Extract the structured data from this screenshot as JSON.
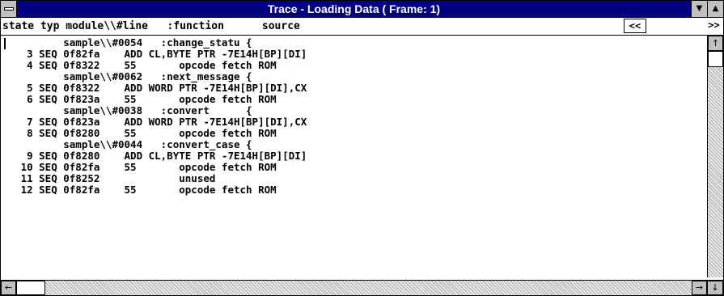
{
  "window": {
    "title": "Trace - Loading Data ( Frame: 1)",
    "system_menu_icon": "system-menu-icon",
    "minimize_glyph": "▼",
    "maximize_glyph": "▲"
  },
  "header": {
    "columns_text": "state typ module\\\\#line   :function      source",
    "scroll_left_label": "<<",
    "scroll_right_label": ">>"
  },
  "trace_lines": [
    "          sample\\\\#0054   :change_statu {",
    "    3 SEQ 0f82fa    ADD CL,BYTE PTR -7E14H[BP][DI]",
    "    4 SEQ 0f8322    55       opcode fetch ROM",
    "          sample\\\\#0062   :next_message {",
    "    5 SEQ 0f8322    ADD WORD PTR -7E14H[BP][DI],CX",
    "    6 SEQ 0f823a    55       opcode fetch ROM",
    "          sample\\\\#0038   :convert      {",
    "    7 SEQ 0f823a    ADD WORD PTR -7E14H[BP][DI],CX",
    "    8 SEQ 0f8280    55       opcode fetch ROM",
    "          sample\\\\#0044   :convert_case {",
    "    9 SEQ 0f8280    ADD CL,BYTE PTR -7E14H[BP][DI]",
    "   10 SEQ 0f82fa    55       opcode fetch ROM",
    "   11 SEQ 0f8252             unused",
    "   12 SEQ 0f82fa    55       opcode fetch ROM"
  ],
  "scrollbars": {
    "up_arrow": "↑",
    "down_arrow": "↓",
    "left_arrow": "←",
    "right_arrow": "→"
  },
  "colors": {
    "titlebar": "#000080",
    "chrome": "#c0c0c0"
  }
}
